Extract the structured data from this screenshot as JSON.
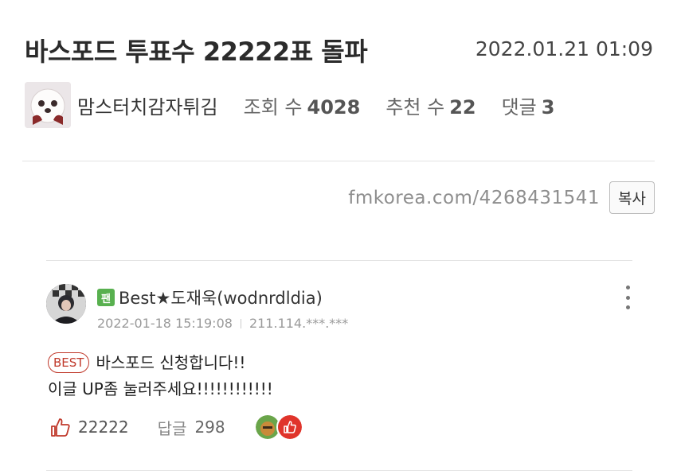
{
  "post": {
    "title": "바스포드 투표수 22222표 돌파",
    "date": "2022.01.21 01:09",
    "author": "맘스터치감자튀김",
    "views_label": "조회 수",
    "views": "4028",
    "recommends_label": "추천 수",
    "recommends": "22",
    "comments_label": "댓글",
    "comments": "3",
    "url": "fmkorea.com/4268431541",
    "copy_label": "복사"
  },
  "comment": {
    "fan_badge": "팬",
    "nickname": "Best★도재욱(wodnrdldia)",
    "date": "2022-01-18 15:19:08",
    "ip": "211.114.***.***",
    "best_badge": "BEST",
    "line1": "바스포드 신청합니다!!",
    "line2": "이글 UP좀 눌러주세요!!!!!!!!!!!!",
    "likes": "22222",
    "reply_label": "답글",
    "replies": "298",
    "accent_color": "#c0392b"
  }
}
